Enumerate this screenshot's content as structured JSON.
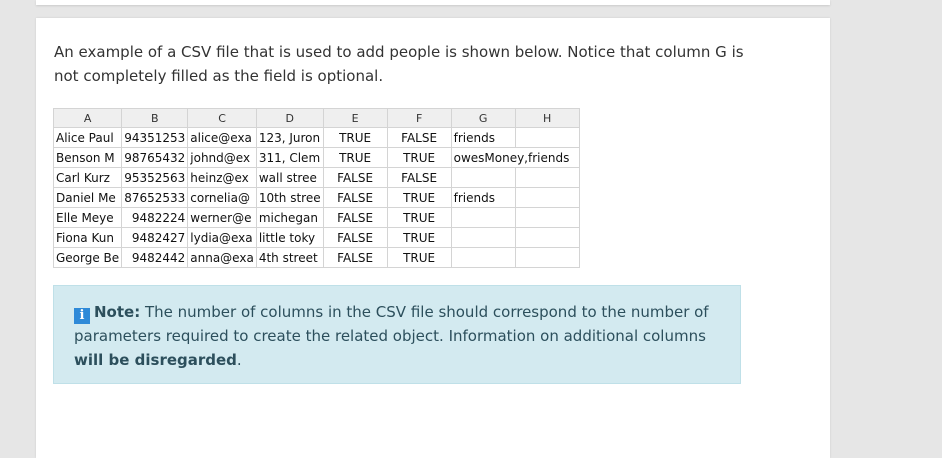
{
  "intro_text": "An example of a CSV file that is used to add people is shown below. Notice that column G is not completely filled as the field is optional.",
  "sheet": {
    "columns": [
      "A",
      "B",
      "C",
      "D",
      "E",
      "F",
      "G",
      "H"
    ],
    "rows": [
      [
        "Alice Paul",
        "94351253",
        "alice@exa",
        "123, Juron",
        "TRUE",
        "FALSE",
        "friends",
        ""
      ],
      [
        "Benson M",
        "98765432",
        "johnd@ex",
        "311, Clem",
        "TRUE",
        "TRUE",
        "owesMoney,friends",
        ""
      ],
      [
        "Carl Kurz",
        "95352563",
        "heinz@ex",
        "wall stree",
        "FALSE",
        "FALSE",
        "",
        ""
      ],
      [
        "Daniel Me",
        "87652533",
        "cornelia@",
        "10th stree",
        "FALSE",
        "TRUE",
        "friends",
        ""
      ],
      [
        "Elle Meye",
        "9482224",
        "werner@e",
        "michegan",
        "FALSE",
        "TRUE",
        "",
        ""
      ],
      [
        "Fiona Kun",
        "9482427",
        "lydia@exa",
        "little toky",
        "FALSE",
        "TRUE",
        "",
        ""
      ],
      [
        "George Be",
        "9482442",
        "anna@exa",
        "4th street",
        "FALSE",
        "TRUE",
        "",
        ""
      ]
    ]
  },
  "note": {
    "icon": "info-icon",
    "label": "Note:",
    "text": " The number of columns in the CSV file should correspond to the number of parameters required to create the related object. Information on additional columns ",
    "emphasis": "will be disregarded",
    "end": "."
  }
}
